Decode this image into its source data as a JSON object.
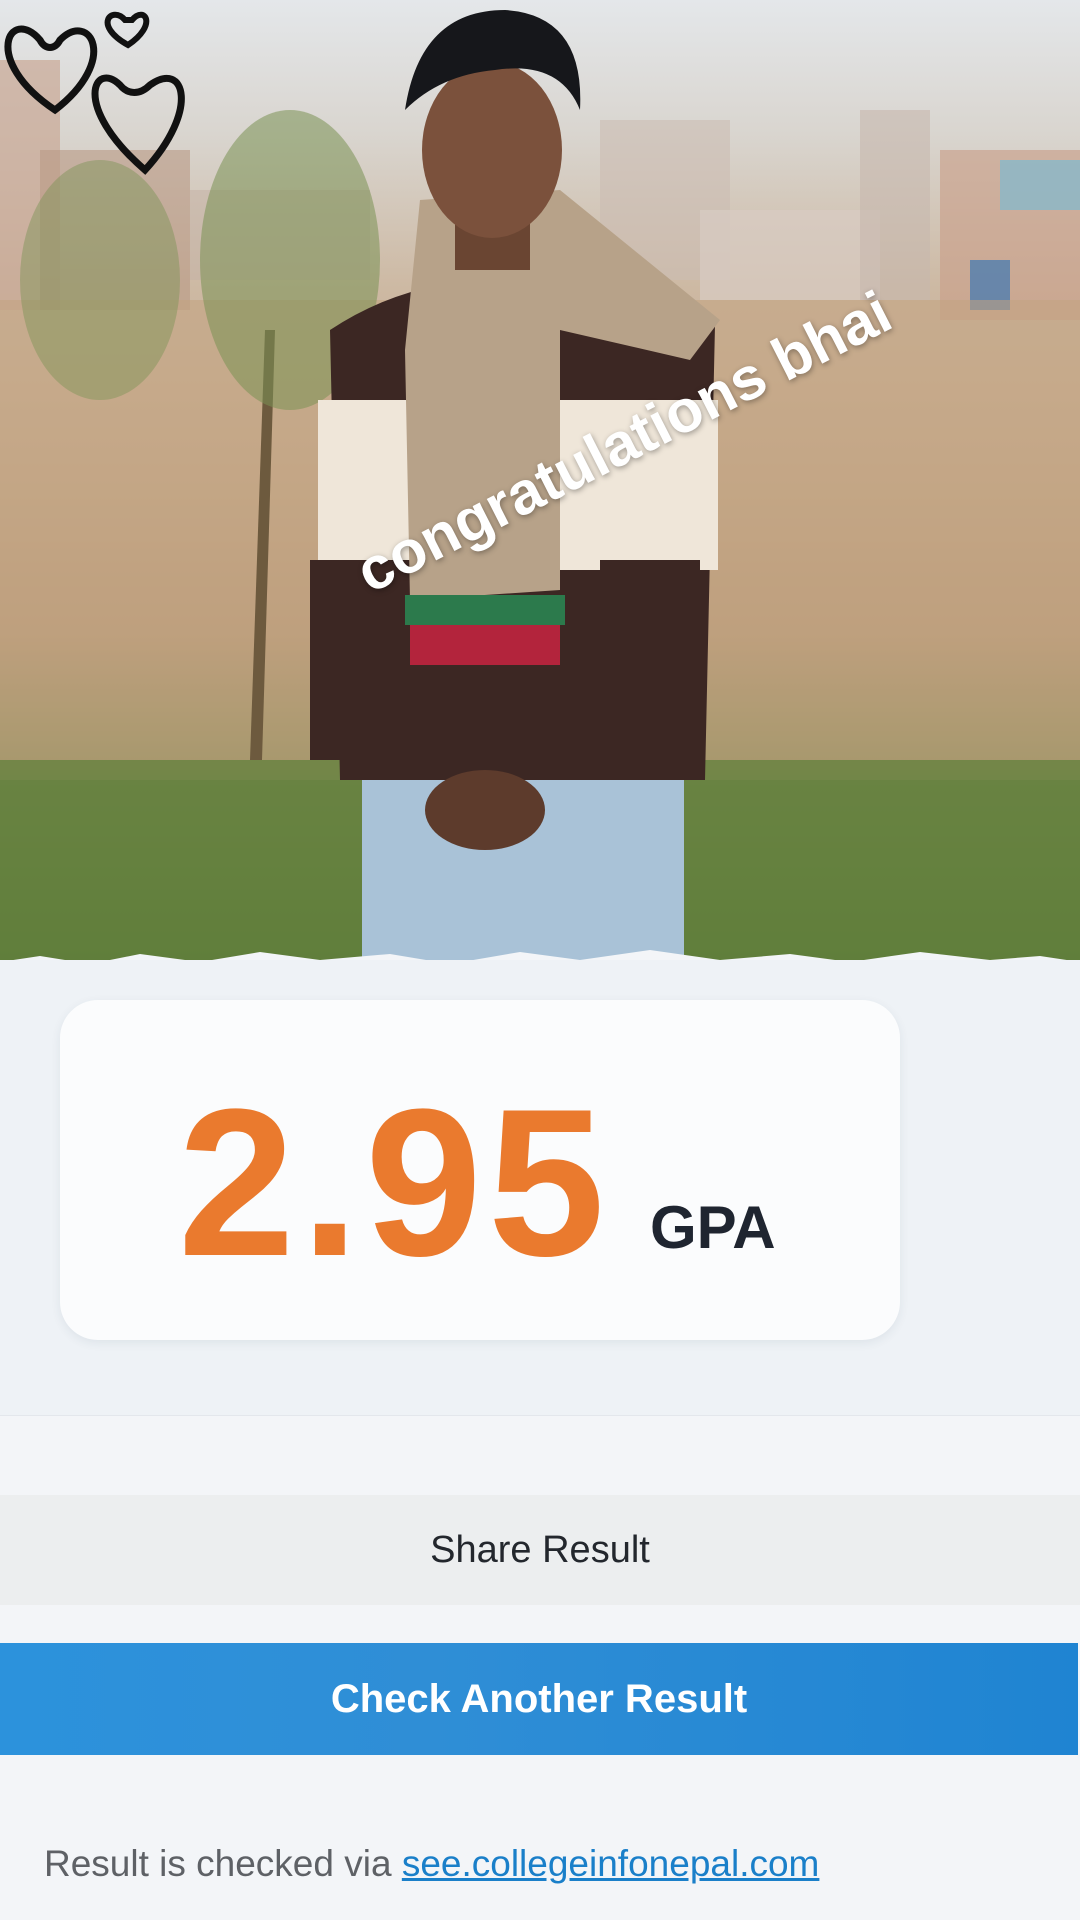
{
  "photo": {
    "overlay_caption": "congratulations  bhai",
    "decoration_icon": "hearts-doodle"
  },
  "result": {
    "gpa_value": "2.95",
    "gpa_unit": "GPA",
    "accent_color": "#ea7a2e"
  },
  "actions": {
    "share_label": "Share Result",
    "check_another_label": "Check Another Result",
    "primary_color": "#2c92dc"
  },
  "footer": {
    "prefix": "Result is checked via",
    "link_text": "see.collegeinfonepal.com"
  }
}
